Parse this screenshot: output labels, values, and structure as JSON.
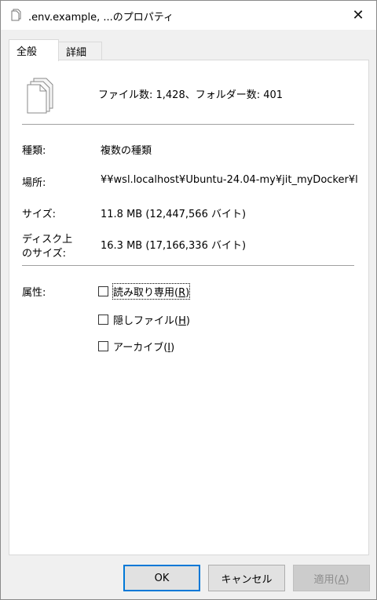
{
  "window": {
    "title": ".env.example, ...のプロパティ",
    "close_symbol": "✕",
    "title_icon": "files-icon"
  },
  "tabs": [
    {
      "label": "全般",
      "active": true
    },
    {
      "label": "詳細",
      "active": false
    }
  ],
  "summary": {
    "text": "ファイル数: 1,428、フォルダー数: 401",
    "icon": "multiple-files-icon"
  },
  "properties": {
    "type_label": "種類:",
    "type_value": "複数の種類",
    "location_label": "場所:",
    "location_value": "¥¥wsl.localhost¥Ubuntu-24.04-my¥jit_myDocker¥l",
    "size_label": "サイズ:",
    "size_value": "11.8 MB (12,447,566 バイト)",
    "disk_size_label_line1": "ディスク上",
    "disk_size_label_line2": "のサイズ:",
    "disk_size_value": "16.3 MB (17,166,336 バイト)"
  },
  "attributes": {
    "label": "属性:",
    "readonly": {
      "text": "読み取り専用(",
      "key": "R",
      "end": ")",
      "checked": false
    },
    "hidden": {
      "text": "隠しファイル(",
      "key": "H",
      "end": ")",
      "checked": false
    },
    "archive": {
      "text": "アーカイブ(",
      "key": "I",
      "end": ")",
      "checked": false
    }
  },
  "buttons": {
    "ok": "OK",
    "cancel": "キャンセル",
    "apply_text": "適用(",
    "apply_key": "A",
    "apply_end": ")"
  }
}
